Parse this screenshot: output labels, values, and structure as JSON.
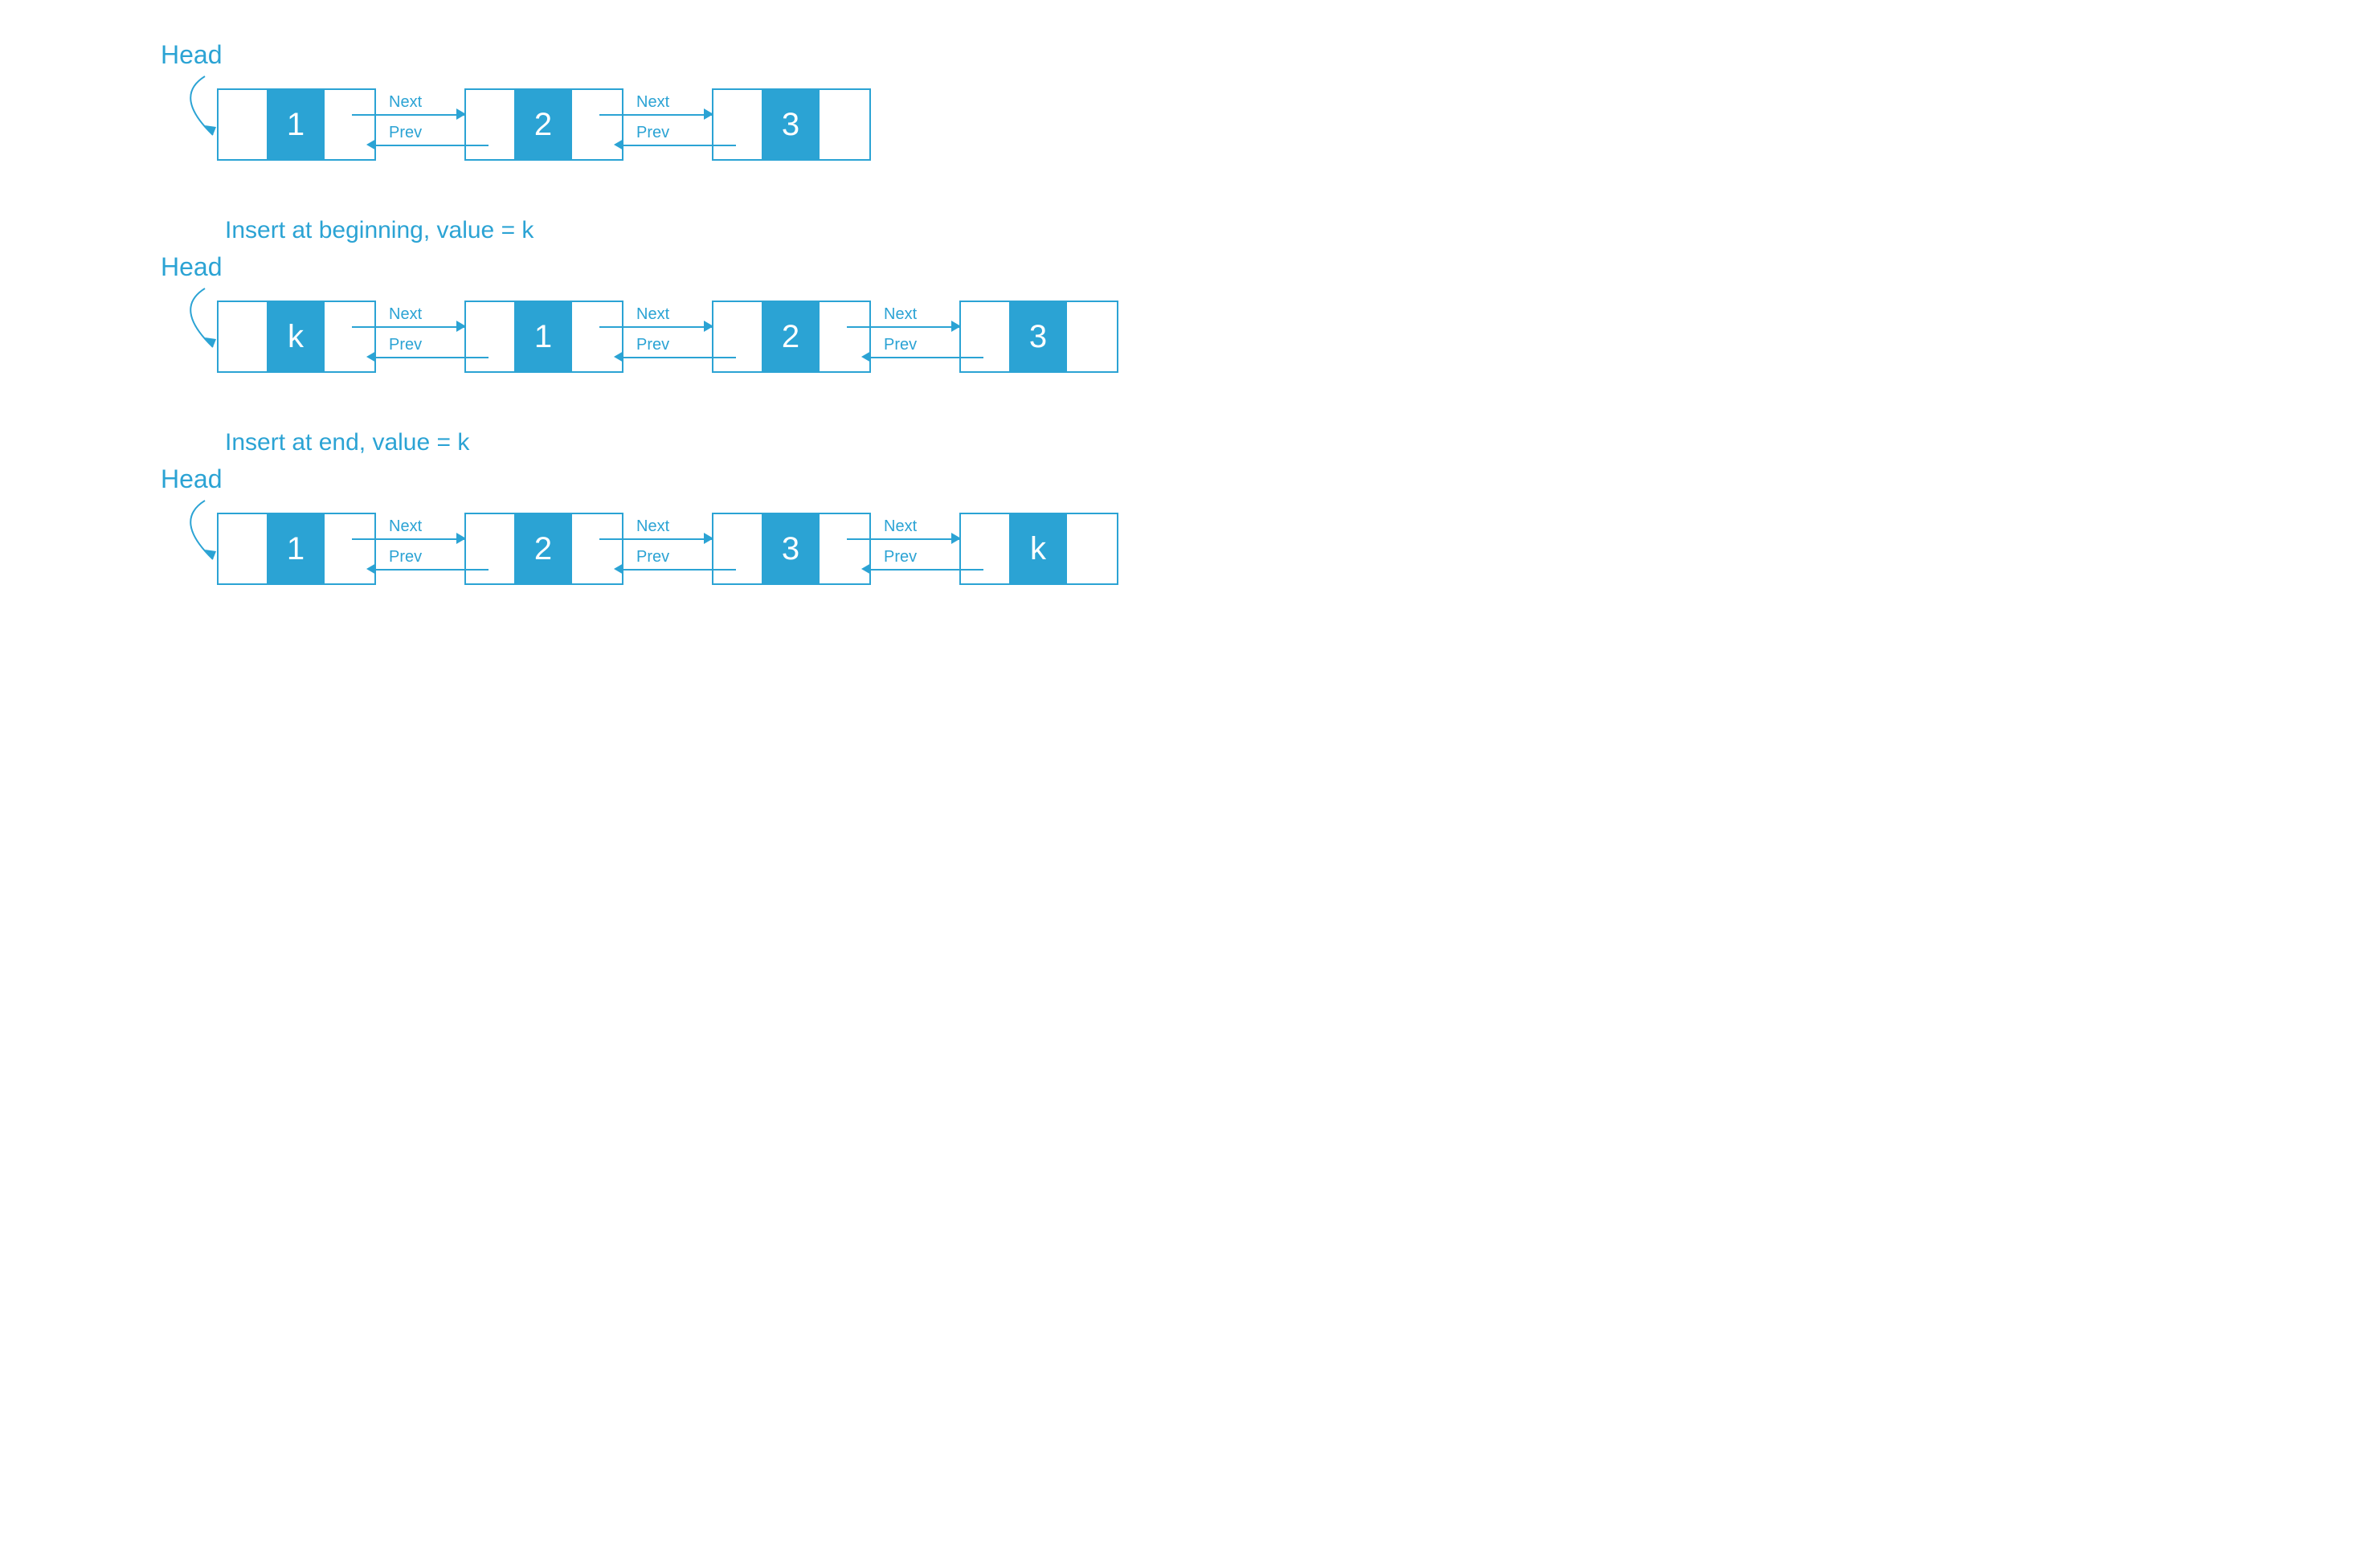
{
  "labels": {
    "head": "Head",
    "next": "Next",
    "prev": "Prev"
  },
  "captions": {
    "insert_begin": "Insert at beginning, value = k",
    "insert_end": "Insert at end, value = k"
  },
  "lists": {
    "original": [
      "1",
      "2",
      "3"
    ],
    "after_begin": [
      "k",
      "1",
      "2",
      "3"
    ],
    "after_end": [
      "1",
      "2",
      "3",
      "k"
    ]
  }
}
